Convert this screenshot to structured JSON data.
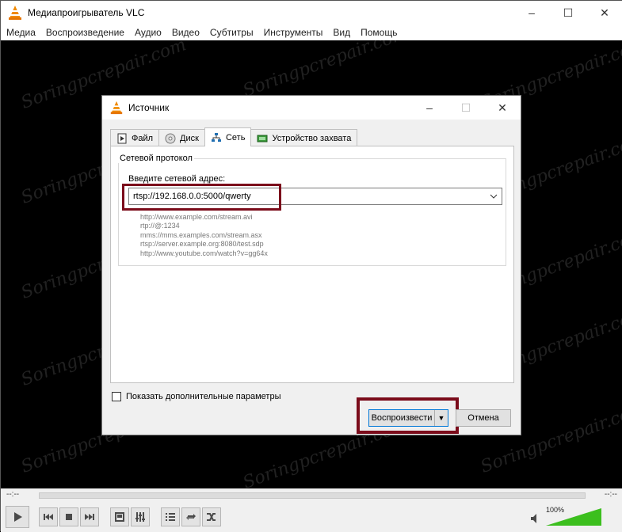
{
  "app": {
    "title": "Медиапроигрыватель VLC",
    "window_controls": [
      "–",
      "☐",
      "✕"
    ]
  },
  "menu": [
    "Медиа",
    "Воспроизведение",
    "Аудио",
    "Видео",
    "Субтитры",
    "Инструменты",
    "Вид",
    "Помощь"
  ],
  "watermark": "Soringpcrepair.com",
  "dialog": {
    "title": "Источник",
    "tabs": [
      {
        "label": "Файл",
        "icon": "file-icon"
      },
      {
        "label": "Диск",
        "icon": "disc-icon"
      },
      {
        "label": "Сеть",
        "icon": "network-icon"
      },
      {
        "label": "Устройство захвата",
        "icon": "capture-device-icon"
      }
    ],
    "active_tab": "Сеть",
    "group_title": "Сетевой протокол",
    "address_label": "Введите сетевой адрес:",
    "address_value": "rtsp://192.168.0.0:5000/qwerty",
    "examples": [
      "http://www.example.com/stream.avi",
      "rtp://@:1234",
      "mms://mms.examples.com/stream.asx",
      "rtsp://server.example.org:8080/test.sdp",
      "http://www.youtube.com/watch?v=gg64x"
    ],
    "extra_options_label": "Показать дополнительные параметры",
    "play_label": "Воспроизвести",
    "cancel_label": "Отмена"
  },
  "player": {
    "time_elapsed": "--:--",
    "time_total": "--:--",
    "volume_label": "100%",
    "volume_level": 1.0,
    "accent_green": "#3cbf1e"
  }
}
